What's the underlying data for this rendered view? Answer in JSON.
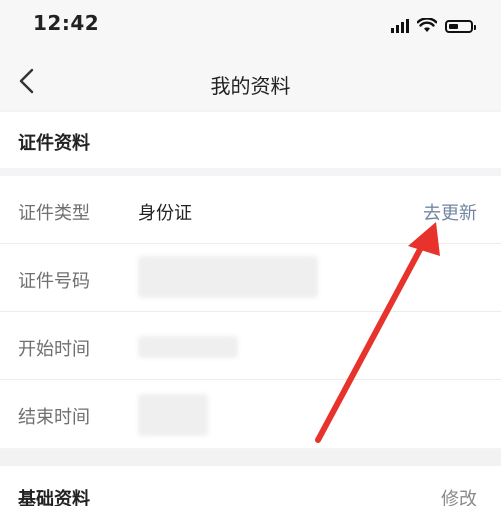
{
  "status_bar": {
    "time": "12:42"
  },
  "nav": {
    "title": "我的资料"
  },
  "sections": {
    "id_info": {
      "title": "证件资料",
      "rows": [
        {
          "label": "证件类型",
          "value": "身份证",
          "action": "去更新"
        },
        {
          "label": "证件号码",
          "value": ""
        },
        {
          "label": "开始时间",
          "value": ""
        },
        {
          "label": "结束时间",
          "value": ""
        }
      ]
    },
    "basic_info": {
      "title": "基础资料",
      "action": "修改"
    }
  },
  "colors": {
    "link": "#7286a3",
    "arrow": "#e8322c"
  }
}
